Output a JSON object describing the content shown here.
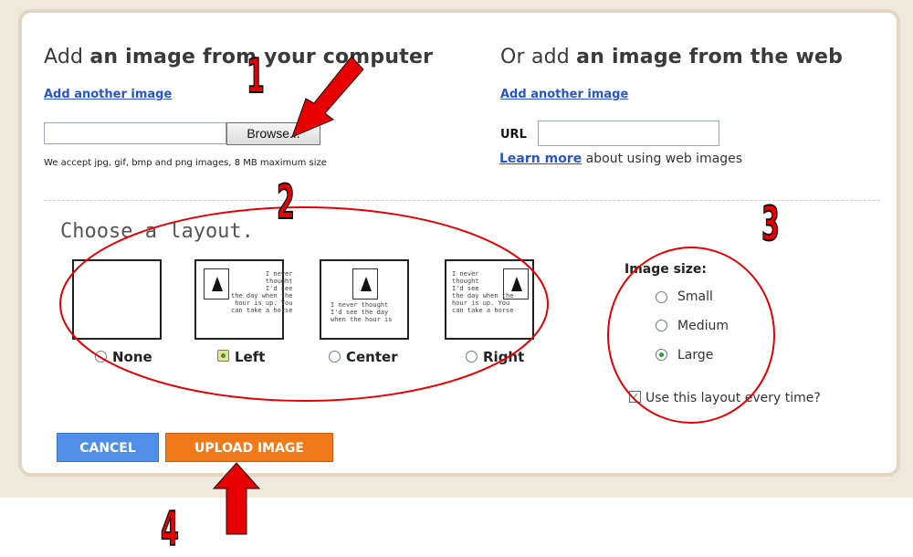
{
  "left_section": {
    "title_prefix": "Add ",
    "title_bold": "an image from your computer",
    "add_link": "Add another image",
    "browse_label": "Browse...",
    "note": "We accept jpg, gif, bmp and png images, 8 MB maximum size"
  },
  "right_section": {
    "title_prefix": "Or add ",
    "title_bold": "an image from the web",
    "add_link": "Add another image",
    "url_label": "URL",
    "learn_link": "Learn more",
    "learn_rest": " about using web images"
  },
  "layout": {
    "title": "Choose a layout.",
    "sample_text_left": "I never\n thought\nI'd see\nthe day when the\n hour is up. You\ncan take a horse",
    "sample_text_center": "I never thought\nI'd see the day\nwhen the hour is",
    "sample_text_right": "I never\nthought\nI'd see\nthe day when the\nhour is up. You\ncan take a horse",
    "options": [
      {
        "label": "None",
        "selected": false
      },
      {
        "label": "Left",
        "selected": true
      },
      {
        "label": "Center",
        "selected": false
      },
      {
        "label": "Right",
        "selected": false
      }
    ]
  },
  "image_size": {
    "title": "Image size:",
    "options": [
      {
        "label": "Small",
        "selected": false
      },
      {
        "label": "Medium",
        "selected": false
      },
      {
        "label": "Large",
        "selected": true
      }
    ],
    "checkbox_label": "Use this layout every time?",
    "checkbox_checked": true
  },
  "buttons": {
    "cancel": "CANCEL",
    "upload": "UPLOAD IMAGE"
  },
  "annotations": {
    "step1": "1",
    "step2": "2",
    "step3": "3",
    "step4": "4",
    "arrow_color": "#e60000"
  }
}
